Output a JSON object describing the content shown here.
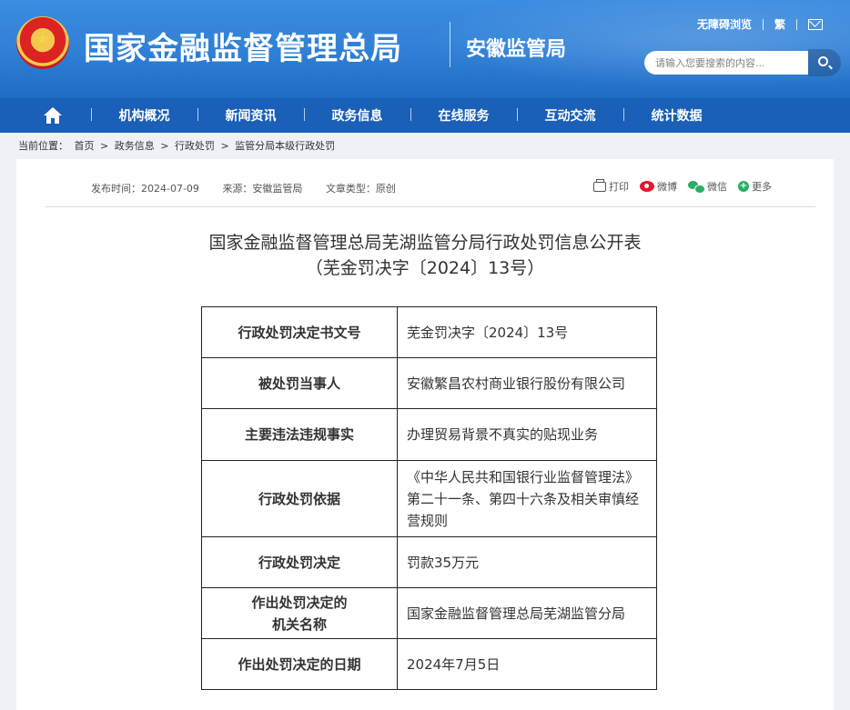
{
  "header": {
    "site_title": "国家金融监督管理总局",
    "branch_name": "安徽监管局",
    "top_links": [
      "无障碍浏览",
      "繁"
    ],
    "search_placeholder": "请输入您要搜索的内容..."
  },
  "nav": {
    "items": [
      "机构概况",
      "新闻资讯",
      "政务信息",
      "在线服务",
      "互动交流",
      "统计数据"
    ]
  },
  "breadcrumb": {
    "prefix": "当前位置：",
    "items": [
      "首页",
      "政务信息",
      "行政处罚",
      "监管分局本级行政处罚"
    ],
    "separator": ">"
  },
  "article": {
    "publish_time": "发布时间：2024-07-09",
    "source": "来源：安徽监管局",
    "type": "文章类型：原创",
    "share": {
      "print": "打印",
      "weibo": "微博",
      "wechat": "微信",
      "more": "更多"
    },
    "title_line1": "国家金融监督管理总局芜湖监管分局行政处罚信息公开表",
    "title_line2": "（芜金罚决字〔2024〕13号）",
    "table": [
      {
        "key": "行政处罚决定书文号",
        "value": "芜金罚决字〔2024〕13号"
      },
      {
        "key": "被处罚当事人",
        "value": "安徽繁昌农村商业银行股份有限公司"
      },
      {
        "key": "主要违法违规事实",
        "value": "办理贸易背景不真实的贴现业务"
      },
      {
        "key": "行政处罚依据",
        "value": "《中华人民共和国银行业监督管理法》第二十一条、第四十六条及相关审慎经营规则"
      },
      {
        "key": "行政处罚决定",
        "value": "罚款35万元"
      },
      {
        "key_line1": "作出处罚决定的",
        "key_line2": "机关名称",
        "value": "国家金融监督管理总局芜湖监管分局"
      },
      {
        "key": "作出处罚决定的日期",
        "value": "2024年7月5日"
      }
    ]
  }
}
